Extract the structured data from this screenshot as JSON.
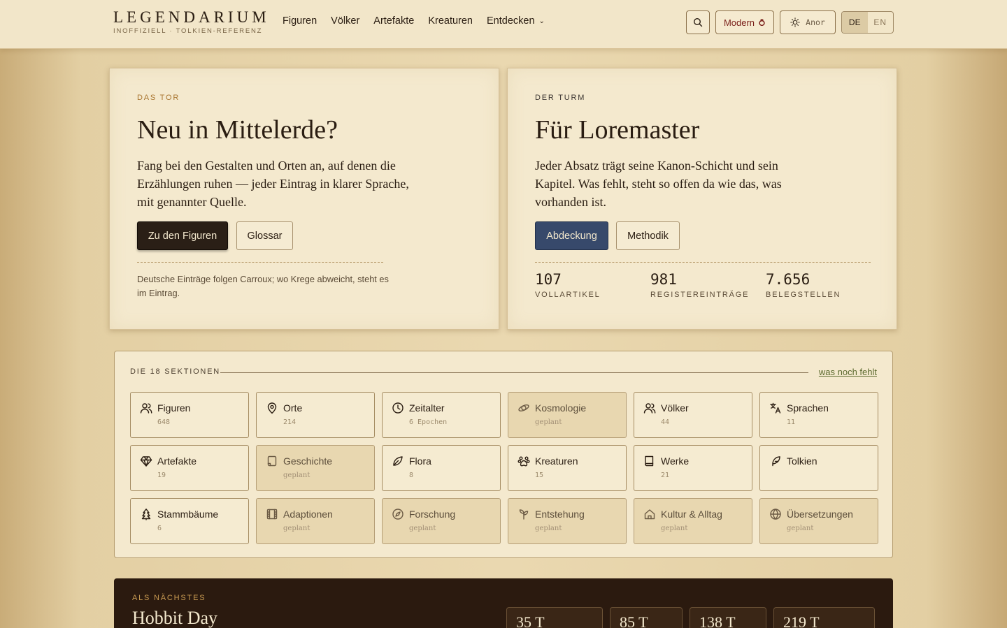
{
  "header": {
    "brand_title": "LEGENDARIUM",
    "brand_subtitle": "INOFFIZIELL · TOLKIEN-REFERENZ",
    "nav": [
      "Figuren",
      "Völker",
      "Artefakte",
      "Kreaturen",
      "Entdecken"
    ],
    "modern_label": "Modern",
    "theme_label": "Anor",
    "lang_active": "DE",
    "lang_other": "EN"
  },
  "left_card": {
    "eyebrow": "DAS TOR",
    "title": "Neu in Mittelerde?",
    "text": "Fang bei den Gestalten und Orten an, auf denen die Erzählungen ruhen — jeder Eintrag in klarer Sprache, mit genannter Quelle.",
    "primary_button": "Zu den Figuren",
    "secondary_button": "Glossar",
    "note": "Deutsche Einträge folgen Carroux; wo Krege abweicht, steht es im Eintrag."
  },
  "right_card": {
    "eyebrow": "DER TURM",
    "title": "Für Loremaster",
    "text": "Jeder Absatz trägt seine Kanon-Schicht und sein Kapitel. Was fehlt, steht so offen da wie das, was vorhanden ist.",
    "primary_button": "Abdeckung",
    "secondary_button": "Methodik",
    "stats": [
      {
        "value": "107",
        "label": "VOLLARTIKEL"
      },
      {
        "value": "981",
        "label": "REGISTEREINTRÄGE"
      },
      {
        "value": "7.656",
        "label": "BELEGSTELLEN"
      }
    ]
  },
  "sections": {
    "heading": "DIE 18 SEKTIONEN",
    "link": "was noch fehlt",
    "tiles": [
      {
        "label": "Figuren",
        "count": "648",
        "icon": "users-icon",
        "planned": false
      },
      {
        "label": "Orte",
        "count": "214",
        "icon": "map-pin-icon",
        "planned": false
      },
      {
        "label": "Zeitalter",
        "count": "6 Epochen",
        "icon": "clock-icon",
        "planned": false
      },
      {
        "label": "Kosmologie",
        "count": "geplant",
        "icon": "orbit-icon",
        "planned": true
      },
      {
        "label": "Völker",
        "count": "44",
        "icon": "users-icon",
        "planned": false
      },
      {
        "label": "Sprachen",
        "count": "11",
        "icon": "translate-icon",
        "planned": false
      },
      {
        "label": "Artefakte",
        "count": "19",
        "icon": "gem-icon",
        "planned": false
      },
      {
        "label": "Geschichte",
        "count": "geplant",
        "icon": "scroll-icon",
        "planned": true
      },
      {
        "label": "Flora",
        "count": "8",
        "icon": "leaf-icon",
        "planned": false
      },
      {
        "label": "Kreaturen",
        "count": "15",
        "icon": "paw-icon",
        "planned": false
      },
      {
        "label": "Werke",
        "count": "21",
        "icon": "book-icon",
        "planned": false
      },
      {
        "label": "Tolkien",
        "count": "",
        "icon": "feather-icon",
        "planned": false
      },
      {
        "label": "Stammbäume",
        "count": "6",
        "icon": "tree-icon",
        "planned": false
      },
      {
        "label": "Adaptionen",
        "count": "geplant",
        "icon": "film-icon",
        "planned": true
      },
      {
        "label": "Forschung",
        "count": "geplant",
        "icon": "compass-icon",
        "planned": true
      },
      {
        "label": "Entstehung",
        "count": "geplant",
        "icon": "sprout-icon",
        "planned": true
      },
      {
        "label": "Kultur & Alltag",
        "count": "geplant",
        "icon": "home-icon",
        "planned": true
      },
      {
        "label": "Übersetzungen",
        "count": "geplant",
        "icon": "globe-icon",
        "planned": true
      }
    ]
  },
  "next": {
    "eyebrow": "ALS NÄCHSTES",
    "title": "Hobbit Day",
    "counters": [
      "35 T",
      "85 T",
      "138 T",
      "219 T"
    ]
  }
}
